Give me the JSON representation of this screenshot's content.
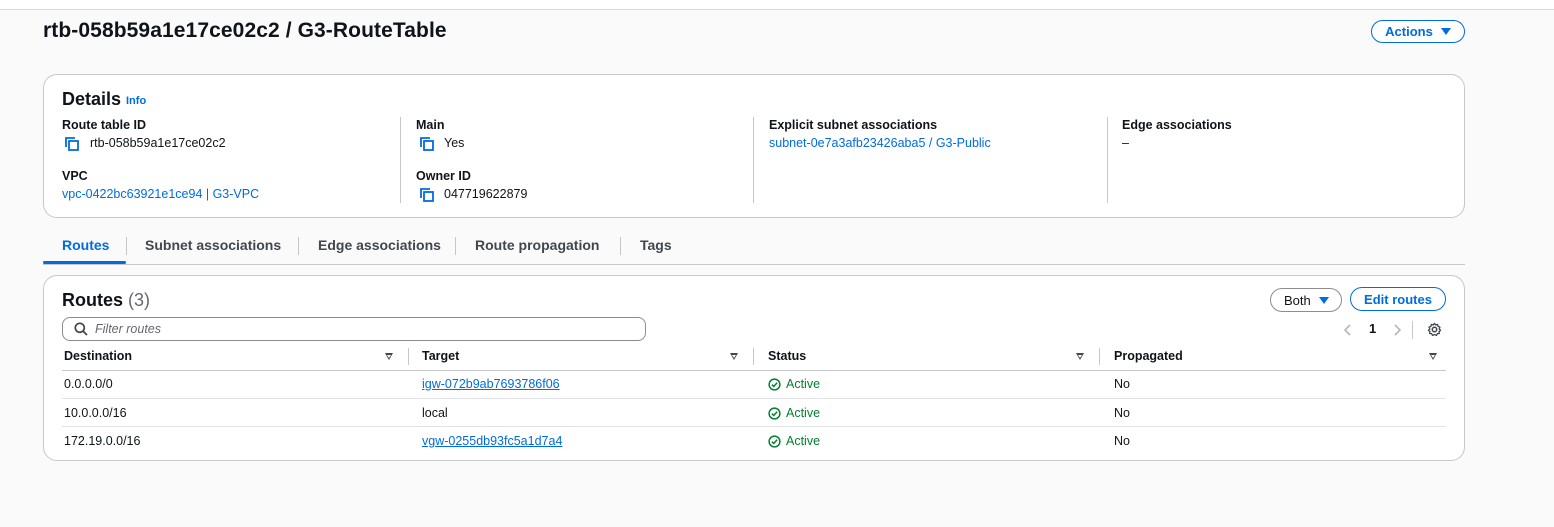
{
  "header": {
    "title": "rtb-058b59a1e17ce02c2 / G3-RouteTable",
    "actions_label": "Actions"
  },
  "details": {
    "title": "Details",
    "info_label": "Info",
    "route_table_id_label": "Route table ID",
    "route_table_id_value": "rtb-058b59a1e17ce02c2",
    "vpc_label": "VPC",
    "vpc_value": "vpc-0422bc63921e1ce94 | G3-VPC",
    "main_label": "Main",
    "main_value": "Yes",
    "owner_id_label": "Owner ID",
    "owner_id_value": "047719622879",
    "explicit_subnet_label": "Explicit subnet associations",
    "explicit_subnet_value": "subnet-0e7a3afb23426aba5 / G3-Public",
    "edge_associations_label": "Edge associations",
    "edge_associations_value": "–"
  },
  "tabs": [
    {
      "label": "Routes",
      "active": true
    },
    {
      "label": "Subnet associations",
      "active": false
    },
    {
      "label": "Edge associations",
      "active": false
    },
    {
      "label": "Route propagation",
      "active": false
    },
    {
      "label": "Tags",
      "active": false
    }
  ],
  "routes": {
    "title": "Routes",
    "count": "(3)",
    "filter_select_value": "Both",
    "edit_button_label": "Edit routes",
    "search_placeholder": "Filter routes",
    "page_number": "1",
    "columns": [
      "Destination",
      "Target",
      "Status",
      "Propagated"
    ],
    "rows": [
      {
        "destination": "0.0.0.0/0",
        "target": "igw-072b9ab7693786f06",
        "target_link": true,
        "status": "Active",
        "propagated": "No"
      },
      {
        "destination": "10.0.0.0/16",
        "target": "local",
        "target_link": false,
        "status": "Active",
        "propagated": "No"
      },
      {
        "destination": "172.19.0.0/16",
        "target": "vgw-0255db93fc5a1d7a4",
        "target_link": true,
        "status": "Active",
        "propagated": "No"
      }
    ]
  },
  "colors": {
    "accent": "#006ce0",
    "success": "#00802f",
    "border": "#c6c6cd"
  },
  "icons": [
    "copy-icon",
    "search-icon",
    "chevron-left-icon",
    "chevron-right-icon",
    "gear-icon",
    "caret-down-icon",
    "check-circle-icon",
    "sort-icon"
  ]
}
